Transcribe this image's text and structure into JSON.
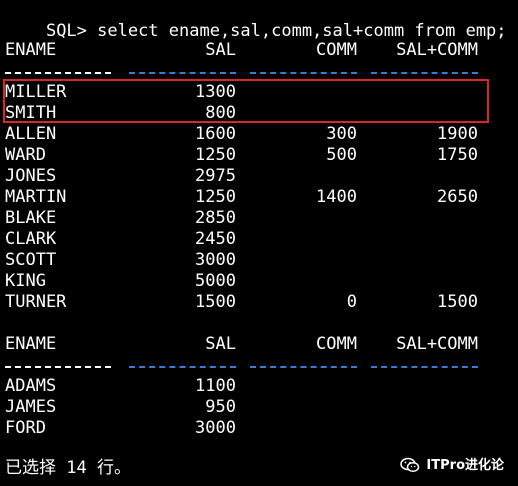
{
  "sql_prompt": "SQL> select ename,sal,comm,sal+comm from emp;",
  "headers": {
    "ename": "ENAME",
    "sal": "SAL",
    "comm": "COMM",
    "sum": "SAL+COMM"
  },
  "table1_rows": [
    {
      "ename": "MILLER",
      "sal": "1300",
      "comm": "",
      "sum": ""
    },
    {
      "ename": "SMITH",
      "sal": "800",
      "comm": "",
      "sum": ""
    },
    {
      "ename": "ALLEN",
      "sal": "1600",
      "comm": "300",
      "sum": "1900"
    },
    {
      "ename": "WARD",
      "sal": "1250",
      "comm": "500",
      "sum": "1750"
    },
    {
      "ename": "JONES",
      "sal": "2975",
      "comm": "",
      "sum": ""
    },
    {
      "ename": "MARTIN",
      "sal": "1250",
      "comm": "1400",
      "sum": "2650"
    },
    {
      "ename": "BLAKE",
      "sal": "2850",
      "comm": "",
      "sum": ""
    },
    {
      "ename": "CLARK",
      "sal": "2450",
      "comm": "",
      "sum": ""
    },
    {
      "ename": "SCOTT",
      "sal": "3000",
      "comm": "",
      "sum": ""
    },
    {
      "ename": "KING",
      "sal": "5000",
      "comm": "",
      "sum": ""
    },
    {
      "ename": "TURNER",
      "sal": "1500",
      "comm": "0",
      "sum": "1500"
    }
  ],
  "table2_rows": [
    {
      "ename": "ADAMS",
      "sal": "1100",
      "comm": "",
      "sum": ""
    },
    {
      "ename": "JAMES",
      "sal": "950",
      "comm": "",
      "sum": ""
    },
    {
      "ename": "FORD",
      "sal": "3000",
      "comm": "",
      "sum": ""
    }
  ],
  "status_text": "已选择 14 行。",
  "watermark_text": "ITPro进化论",
  "colors": {
    "background": "#000000",
    "text": "#ffffff",
    "separator": "#3a7bd5",
    "highlight": "#d9262b"
  }
}
